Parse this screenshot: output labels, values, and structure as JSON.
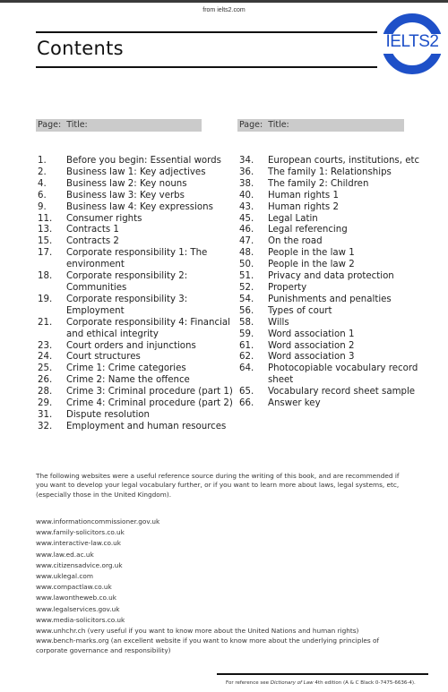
{
  "header": {
    "source_note": "from ielts2.com",
    "title": "Contents",
    "logo_text": "IELTS2",
    "logo_color": "#1e50c8"
  },
  "columns": {
    "page_label": "Page:",
    "title_label": "Title:"
  },
  "toc_left": [
    {
      "page": "1.",
      "title": "Before you begin: Essential words"
    },
    {
      "page": "2.",
      "title": "Business law 1: Key adjectives"
    },
    {
      "page": "4.",
      "title": "Business law 2: Key nouns"
    },
    {
      "page": "6.",
      "title": "Business law 3: Key verbs"
    },
    {
      "page": "9.",
      "title": "Business law 4: Key expressions"
    },
    {
      "page": "11.",
      "title": "Consumer rights"
    },
    {
      "page": "13.",
      "title": "Contracts 1"
    },
    {
      "page": "15.",
      "title": "Contracts 2"
    },
    {
      "page": "17.",
      "title": "Corporate responsibility 1: The environment"
    },
    {
      "page": "18.",
      "title": "Corporate responsibility 2: Communities"
    },
    {
      "page": "19.",
      "title": "Corporate responsibility 3: Employment"
    },
    {
      "page": "21.",
      "title": "Corporate responsibility 4: Financial and ethical integrity"
    },
    {
      "page": "23.",
      "title": "Court orders and injunctions"
    },
    {
      "page": "24.",
      "title": "Court structures"
    },
    {
      "page": "25.",
      "title": "Crime 1: Crime categories"
    },
    {
      "page": "26.",
      "title": "Crime 2: Name the offence"
    },
    {
      "page": "28.",
      "title": "Crime 3: Criminal procedure (part 1)"
    },
    {
      "page": "29.",
      "title": "Crime 4: Criminal procedure (part 2)"
    },
    {
      "page": "31.",
      "title": "Dispute resolution"
    },
    {
      "page": "32.",
      "title": "Employment and human resources"
    }
  ],
  "toc_right": [
    {
      "page": "34.",
      "title": "European courts, institutions, etc"
    },
    {
      "page": "36.",
      "title": "The family 1: Relationships"
    },
    {
      "page": "38.",
      "title": "The family 2: Children"
    },
    {
      "page": "40.",
      "title": "Human rights 1"
    },
    {
      "page": "43.",
      "title": "Human rights 2"
    },
    {
      "page": "45.",
      "title": "Legal Latin"
    },
    {
      "page": "46.",
      "title": "Legal referencing"
    },
    {
      "page": "47.",
      "title": "On the road"
    },
    {
      "page": "48.",
      "title": "People in the law 1"
    },
    {
      "page": "50.",
      "title": "People in the law 2"
    },
    {
      "page": "51.",
      "title": "Privacy and data protection"
    },
    {
      "page": "52.",
      "title": "Property"
    },
    {
      "page": "54.",
      "title": "Punishments and penalties"
    },
    {
      "page": "56.",
      "title": "Types of court"
    },
    {
      "page": "58.",
      "title": "Wills"
    },
    {
      "page": "59.",
      "title": "Word association 1"
    },
    {
      "page": "61.",
      "title": "Word association 2"
    },
    {
      "page": "62.",
      "title": "Word association 3"
    },
    {
      "page": "64.",
      "title": "Photocopiable vocabulary record sheet"
    },
    {
      "page": "65.",
      "title": "Vocabulary record sheet sample"
    },
    {
      "page": "66.",
      "title": "Answer key"
    }
  ],
  "intro_paragraph": "The following websites were a useful reference source during the writing of this book, and are recommended if you want to develop your legal vocabulary further, or if you want to learn more about laws, legal systems, etc, (especially those in the United Kingdom).",
  "websites": [
    {
      "url": "www.informationcommissioner.gov.uk",
      "note": ""
    },
    {
      "url": "www.family-solicitors.co.uk",
      "note": ""
    },
    {
      "url": "www.interactive-law.co.uk",
      "note": ""
    },
    {
      "url": "www.law.ed.ac.uk",
      "note": ""
    },
    {
      "url": "www.citizensadvice.org.uk",
      "note": ""
    },
    {
      "url": "www.uklegal.com",
      "note": ""
    },
    {
      "url": "www.compactlaw.co.uk",
      "note": ""
    },
    {
      "url": "www.lawontheweb.co.uk",
      "note": ""
    },
    {
      "url": "www.legalservices.gov.uk",
      "note": ""
    },
    {
      "url": "www.media-solicitors.co.uk",
      "note": ""
    },
    {
      "url": "www.unhchr.ch",
      "note": " (very useful if you want to know more about the United Nations and human rights)"
    },
    {
      "url": "www.bench-marks.org",
      "note": " (an excellent website if you want to know more about the underlying principles of corporate governance and responsibility)"
    }
  ],
  "footer": {
    "prefix": "For reference see ",
    "book_title": "Dictionary of Law",
    "suffix": " 4th edition  (A & C Black 0-7475-6636-4)."
  }
}
